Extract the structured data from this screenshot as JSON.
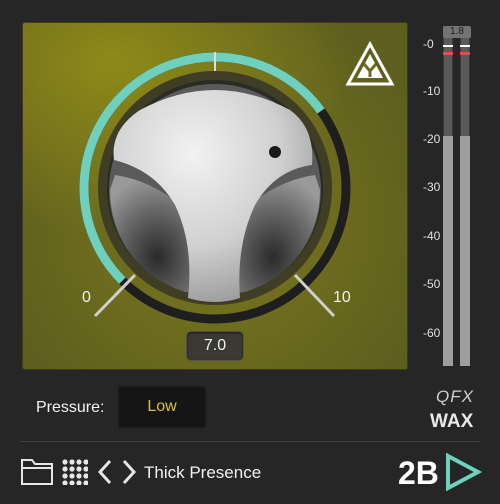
{
  "knob": {
    "value_display": "7.0",
    "value": 7.0,
    "min_label": "0",
    "max_label": "10",
    "arc_color": "#6fd0be"
  },
  "meter": {
    "peak_readout": "1.8",
    "ticks": [
      "-0",
      "-10",
      "-20",
      "-30",
      "-40",
      "-50",
      "-60"
    ]
  },
  "pressure": {
    "label": "Pressure:",
    "value": "Low",
    "value_color": "#d9c13a"
  },
  "product": {
    "line1": "QFX",
    "line2": "WAX"
  },
  "preset": {
    "name": "Thick Presence"
  },
  "icons": {
    "folder": "folder-icon",
    "grid": "grid-icon",
    "prev": "chevron-left-icon",
    "next": "chevron-right-icon",
    "logo": "y-triangle-logo-icon",
    "brand": "2b-logo-icon"
  },
  "brand": {
    "text": "2B"
  }
}
